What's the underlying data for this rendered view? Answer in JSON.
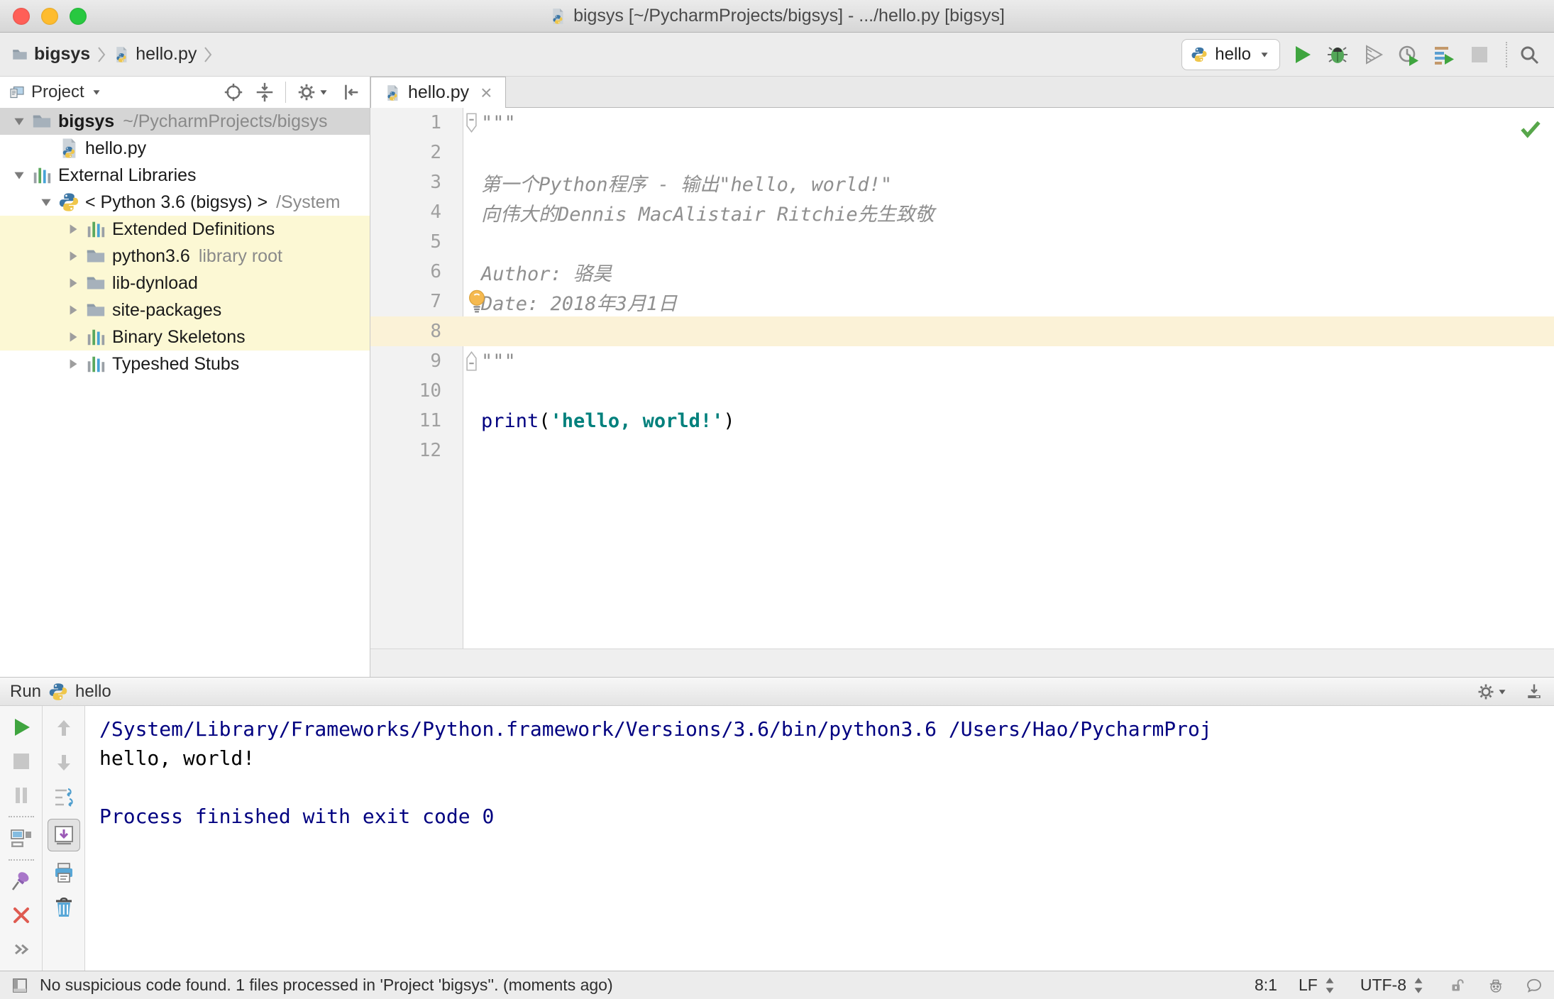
{
  "titlebar": {
    "title": "bigsys [~/PycharmProjects/bigsys] - .../hello.py [bigsys]"
  },
  "navbar": {
    "breadcrumbs": [
      {
        "icon": "folder",
        "label": "bigsys",
        "bold": true
      },
      {
        "icon": "pyfile",
        "label": "hello.py",
        "bold": false
      }
    ],
    "run_config": {
      "icon": "pylogo",
      "label": "hello"
    },
    "actions": [
      {
        "name": "run"
      },
      {
        "name": "debug"
      },
      {
        "name": "coverage"
      },
      {
        "name": "profiler"
      },
      {
        "name": "concurrency"
      },
      {
        "name": "stop",
        "disabled": true
      },
      {
        "sep": true
      },
      {
        "name": "search"
      }
    ]
  },
  "project": {
    "title": "Project",
    "actions": [
      {
        "name": "locate"
      },
      {
        "name": "collapse-all"
      },
      {
        "bar": true
      },
      {
        "name": "settings",
        "arrow": true
      },
      {
        "name": "hide-panel"
      }
    ],
    "tree": [
      {
        "level": 0,
        "chevron": "down",
        "icon": "folder",
        "label": "bigsys",
        "suffix": "~/PycharmProjects/bigsys",
        "selected": true,
        "bold": true
      },
      {
        "level": 1,
        "chevron": null,
        "icon": "pyfile",
        "label": "hello.py"
      },
      {
        "level": 0,
        "chevron": "down",
        "icon": "library",
        "label": "External Libraries"
      },
      {
        "level": 1,
        "chevron": "down",
        "icon": "pylogo",
        "label": "< Python 3.6 (bigsys) >",
        "suffix": "/System"
      },
      {
        "level": 2,
        "chevron": "right",
        "icon": "library",
        "label": "Extended Definitions",
        "highlighted": true
      },
      {
        "level": 2,
        "chevron": "right",
        "icon": "folder",
        "label": "python3.6",
        "suffix": "library root",
        "highlighted": true
      },
      {
        "level": 2,
        "chevron": "right",
        "icon": "folder",
        "label": "lib-dynload",
        "highlighted": true
      },
      {
        "level": 2,
        "chevron": "right",
        "icon": "folder",
        "label": "site-packages",
        "highlighted": true
      },
      {
        "level": 2,
        "chevron": "right",
        "icon": "library",
        "label": "Binary Skeletons",
        "highlighted": true
      },
      {
        "level": 2,
        "chevron": "right",
        "icon": "library",
        "label": "Typeshed Stubs"
      }
    ]
  },
  "editor": {
    "tab": {
      "icon": "pyfile",
      "label": "hello.py",
      "close": "×"
    },
    "inspection_status": "no-problems",
    "lines": [
      {
        "n": 1,
        "fold": "start",
        "tokens": [
          {
            "t": "\"\"\"",
            "c": "doc"
          }
        ]
      },
      {
        "n": 2,
        "tokens": []
      },
      {
        "n": 3,
        "tokens": [
          {
            "t": "第一个Python程序 - 输出\"hello, world!\"",
            "c": "doc"
          }
        ]
      },
      {
        "n": 4,
        "tokens": [
          {
            "t": "向伟大的Dennis MacAlistair Ritchie先生致敬",
            "c": "doc"
          }
        ]
      },
      {
        "n": 5,
        "tokens": []
      },
      {
        "n": 6,
        "tokens": [
          {
            "t": "Author: 骆昊",
            "c": "doc"
          }
        ]
      },
      {
        "n": 7,
        "bulb": true,
        "tokens": [
          {
            "t": "Date: 2018年3月1日",
            "c": "doc"
          }
        ]
      },
      {
        "n": 8,
        "caret": true,
        "tokens": []
      },
      {
        "n": 9,
        "fold": "end",
        "tokens": [
          {
            "t": "\"\"\"",
            "c": "doc"
          }
        ]
      },
      {
        "n": 10,
        "tokens": []
      },
      {
        "n": 11,
        "tokens": [
          {
            "t": "print",
            "c": "kw"
          },
          {
            "t": "(",
            "c": "plain"
          },
          {
            "t": "'hello, world!'",
            "c": "str"
          },
          {
            "t": ")",
            "c": "plain"
          }
        ]
      },
      {
        "n": 12,
        "tokens": []
      }
    ]
  },
  "run": {
    "label": "Run",
    "config": "hello",
    "config_icon": "pylogo",
    "header_actions": [
      {
        "name": "settings",
        "arrow": true
      },
      {
        "name": "hide-down"
      }
    ],
    "toolbar_left": [
      {
        "name": "rerun"
      },
      {
        "name": "stop",
        "disabled": true
      },
      {
        "name": "pause",
        "disabled": true
      },
      {
        "sep": true
      },
      {
        "name": "show-layouts"
      },
      {
        "sep": true
      },
      {
        "name": "pin"
      },
      {
        "name": "close"
      },
      {
        "name": "more"
      }
    ],
    "toolbar_right": [
      {
        "name": "up-stack",
        "disabled": true
      },
      {
        "name": "down-stack",
        "disabled": true
      },
      {
        "name": "soft-wrap"
      },
      {
        "name": "scroll-end",
        "selected": true
      },
      {
        "name": "print"
      },
      {
        "name": "clear-all"
      }
    ],
    "console": [
      {
        "text": "/System/Library/Frameworks/Python.framework/Versions/3.6/bin/python3.6 /Users/Hao/PycharmProj",
        "color": "info"
      },
      {
        "text": "hello, world!",
        "color": "stdout"
      },
      {
        "text": "",
        "color": "stdout"
      },
      {
        "text": "Process finished with exit code 0",
        "color": "info"
      }
    ]
  },
  "statusbar": {
    "message": "No suspicious code found. 1 files processed in 'Project 'bigsys''. (moments ago)",
    "position": "8:1",
    "line_separator": "LF",
    "encoding": "UTF-8"
  },
  "colors": {
    "run_green": "#3fa53f",
    "keyword_blue": "#000080",
    "string_teal": "#00807c",
    "doc_gray": "#8f8f8f",
    "console_blue": "#000080",
    "caret_line": "#fbf2d7",
    "tree_highlight": "#fcf8d4"
  }
}
